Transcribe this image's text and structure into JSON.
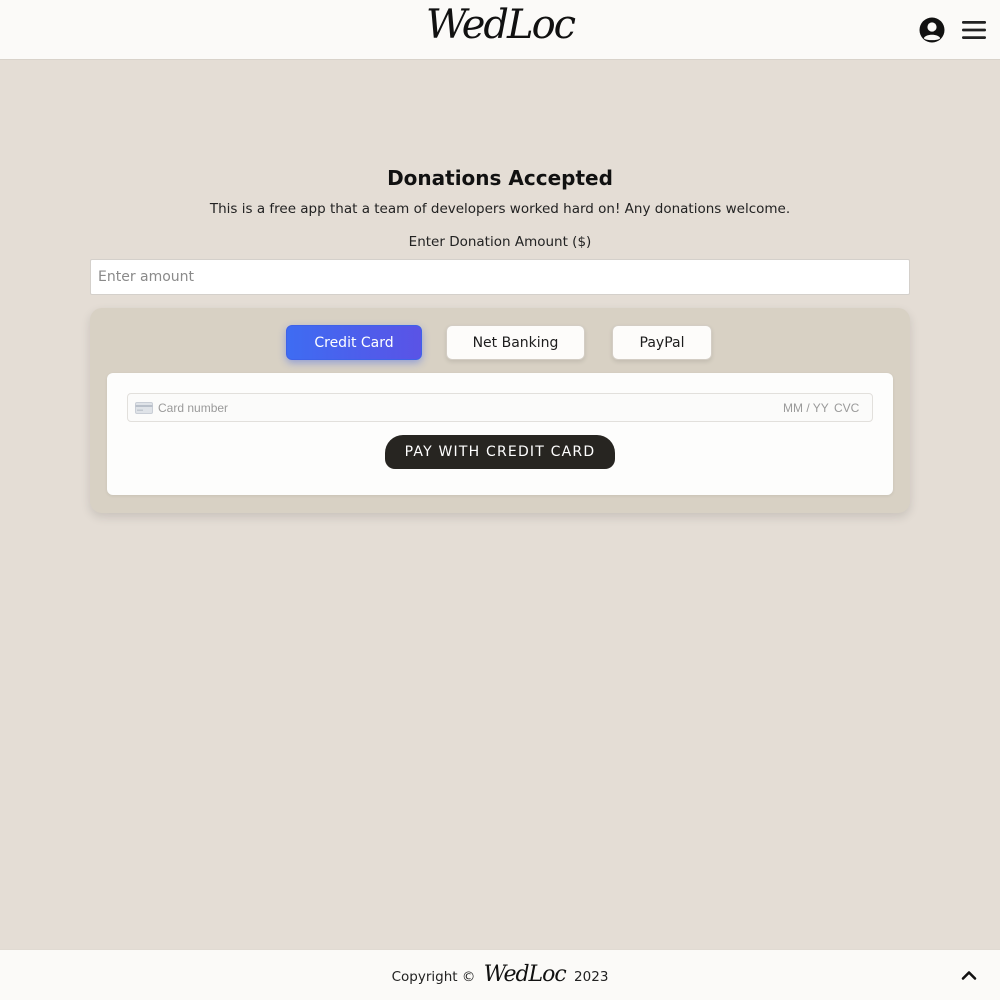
{
  "header": {
    "logo": "WedLoc",
    "user_icon": "user-circle-icon",
    "menu_icon": "hamburger-menu-icon"
  },
  "main": {
    "title": "Donations Accepted",
    "subtitle": "This is a free app that a team of developers worked hard on! Any donations welcome.",
    "amount_label": "Enter Donation Amount ($)",
    "amount_placeholder": "Enter amount",
    "amount_value": ""
  },
  "payment": {
    "tabs": [
      {
        "label": "Credit Card",
        "active": true
      },
      {
        "label": "Net Banking",
        "active": false
      },
      {
        "label": "PayPal",
        "active": false
      }
    ],
    "card_icon": "credit-card-icon",
    "card_number_placeholder": "Card number",
    "expiry_placeholder": "MM / YY",
    "cvc_placeholder": "CVC",
    "pay_button_label": "PAY WITH CREDIT CARD"
  },
  "footer": {
    "copyright_prefix": "Copyright ©",
    "logo": "WedLoc",
    "year": "2023",
    "scroll_icon": "chevron-up-icon"
  },
  "colors": {
    "background": "#e4ddd5",
    "panel": "#d8d1c4",
    "accent": "#3e6cf2",
    "button_dark": "#272521"
  }
}
